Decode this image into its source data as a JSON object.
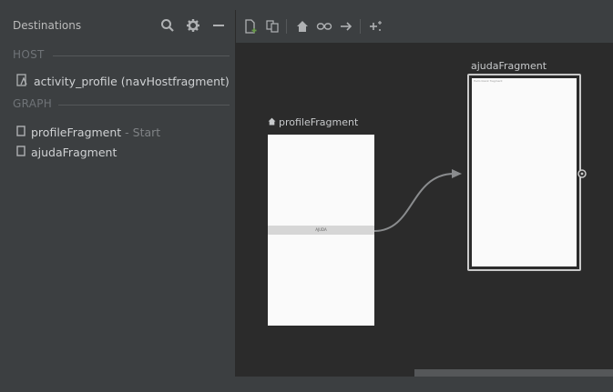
{
  "panel": {
    "title": "Destinations",
    "host_section": "HOST",
    "host_item": "activity_profile (navHostfragment)",
    "graph_section": "GRAPH",
    "destinations": [
      {
        "name": "profileFragment",
        "suffix": " - Start"
      },
      {
        "name": "ajudaFragment",
        "suffix": ""
      }
    ]
  },
  "icons": {
    "panel": [
      "search-icon",
      "gear-icon",
      "minimize-icon"
    ],
    "toolbar": [
      "new-destination-icon",
      "nested-graph-icon",
      "home-icon",
      "deeplink-icon",
      "action-arrow-icon",
      "auto-arrange-icon"
    ]
  },
  "canvas": {
    "profile_label": "profileFragment",
    "profile_button_text": "AJUDA",
    "ajuda_label": "ajudaFragment",
    "ajuda_text": "Hello blank fragment"
  },
  "colors": {
    "accent_green": "#6a9a4b",
    "panel_bg": "#3c3f41",
    "canvas_bg": "#2b2b2b"
  }
}
